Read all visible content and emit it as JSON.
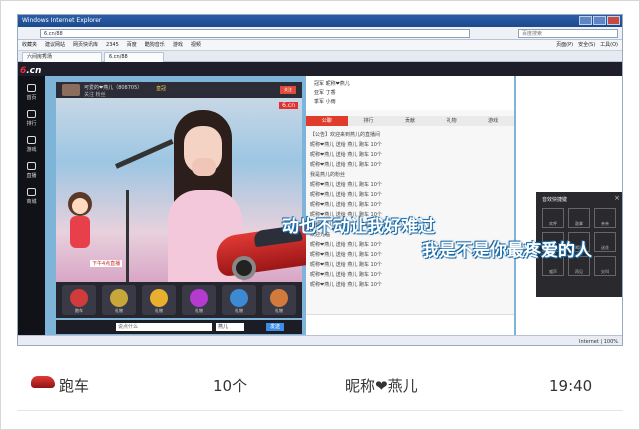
{
  "browser": {
    "window_title": "Windows Internet Explorer",
    "address": "6.cn/88",
    "search_placeholder": "百度搜索",
    "favorites": [
      "收藏夹",
      "建议网站",
      "网页快讯库",
      "2345",
      "百度",
      "酷狗音乐",
      "游戏",
      "视频"
    ],
    "toolbar_right": [
      "页面(P)",
      "安全(S)",
      "工具(O)"
    ],
    "tabs": [
      "六间房秀场",
      "6.cn/88"
    ],
    "status_text": "Internet",
    "zoom": "100%"
  },
  "site": {
    "logo_num": "6",
    "logo_text": ".cn",
    "nav": [
      "首页",
      "排行",
      "游戏",
      "直播",
      "商城"
    ]
  },
  "video": {
    "host_name": "可爱的❤燕儿（808705）",
    "host_sub": "关注 粉丝",
    "level": "皇冠",
    "follow": "关注",
    "brand": "6.cn",
    "flag": "下午4点直播",
    "gift_labels": [
      "跑车",
      "礼物",
      "礼物",
      "礼物",
      "礼物",
      "礼物"
    ],
    "gift_colors": [
      "#d23b3b",
      "#c7a63a",
      "#e8b02e",
      "#b53bd0",
      "#3b8ad2",
      "#d27a3b"
    ]
  },
  "lyrics": {
    "line1": "动也不动让我好难过",
    "line2": "我是不是你最疼爱的人"
  },
  "controls": {
    "input_placeholder": "说点什么",
    "target": "燕儿",
    "send": "发送"
  },
  "chat": {
    "ranks": [
      "冠军 昵称❤燕儿",
      "亚军 丁香",
      "季军 小雨"
    ],
    "tabs": [
      "公聊",
      "排行",
      "贡献",
      "礼物",
      "游戏"
    ],
    "messages": [
      "【公告】欢迎来到燕儿的直播间",
      "昵称❤燕儿 送给 燕儿 跑车 10个",
      "昵称❤燕儿 送给 燕儿 跑车 10个",
      "昵称❤燕儿 送给 燕儿 跑车 10个",
      "我是燕儿的粉丝",
      "昵称❤燕儿 送给 燕儿 跑车 10个",
      "昵称❤燕儿 送给 燕儿 跑车 10个",
      "昵称❤燕儿 送给 燕儿 跑车 10个",
      "昵称❤燕儿 送给 燕儿 跑车 10个",
      "昵称❤燕儿 送给 燕儿 跑车 10个",
      "欢迎光临",
      "昵称❤燕儿 送给 燕儿 跑车 10个",
      "昵称❤燕儿 送给 燕儿 跑车 10个",
      "昵称❤燕儿 送给 燕儿 跑车 10个",
      "昵称❤燕儿 送给 燕儿 跑车 10个",
      "昵称❤燕儿 送给 燕儿 跑车 10个"
    ],
    "send": "发送"
  },
  "panel": {
    "title": "音效快捷键",
    "cells": [
      "欢呼",
      "鼓掌",
      "亲亲",
      "大笑",
      "喝彩",
      "送花",
      "嘘声",
      "再见",
      "尖叫"
    ]
  },
  "record": {
    "item": "跑车",
    "count": "10个",
    "nickname": "昵称❤燕儿",
    "time": "19:40"
  }
}
